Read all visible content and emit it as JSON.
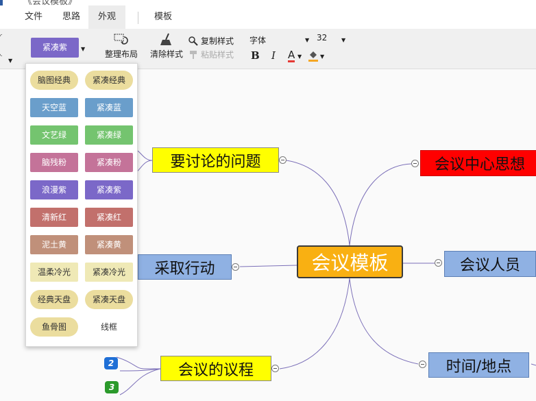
{
  "title": {
    "text": "《会议模板》"
  },
  "menu": {
    "tabs": [
      {
        "label": "文件"
      },
      {
        "label": "思路"
      },
      {
        "label": "外观"
      },
      {
        "label": "模板"
      }
    ]
  },
  "toolbar": {
    "theme_label": "紧凑紫",
    "layout_label": "整理布局",
    "clear_style_label": "清除样式",
    "copy_style_label": "复制样式",
    "paste_style_label": "粘贴样式",
    "font_name": "字体",
    "font_size": "32",
    "bold_label": "B",
    "italic_label": "I",
    "font_color_label": "A"
  },
  "theme_panel": {
    "rows": [
      [
        {
          "label": "脑图经典",
          "bg": "#ebdd9e",
          "shape": "pill"
        },
        {
          "label": "紧凑经典",
          "bg": "#ebdd9e",
          "shape": "pill"
        }
      ],
      [
        {
          "label": "天空蓝",
          "bg": "#6a9ecb"
        },
        {
          "label": "紧凑蓝",
          "bg": "#6a9ecb"
        }
      ],
      [
        {
          "label": "文艺绿",
          "bg": "#74c46f"
        },
        {
          "label": "紧凑绿",
          "bg": "#74c46f"
        }
      ],
      [
        {
          "label": "脑残粉",
          "bg": "#c47399"
        },
        {
          "label": "紧凑粉",
          "bg": "#c47399"
        }
      ],
      [
        {
          "label": "浪漫紫",
          "bg": "#7b68c8"
        },
        {
          "label": "紧凑紫",
          "bg": "#7b68c8"
        }
      ],
      [
        {
          "label": "清新红",
          "bg": "#c2706c"
        },
        {
          "label": "紧凑红",
          "bg": "#c2706c"
        }
      ],
      [
        {
          "label": "泥土黄",
          "bg": "#c0907a"
        },
        {
          "label": "紧凑黄",
          "bg": "#c0907a"
        }
      ],
      [
        {
          "label": "温柔冷光",
          "bg": "#efe9b6",
          "shape": "flat"
        },
        {
          "label": "紧凑冷光",
          "bg": "#efe9b6",
          "shape": "flat"
        }
      ],
      [
        {
          "label": "经典天盘",
          "bg": "#ebdd9e",
          "shape": "pill"
        },
        {
          "label": "紧凑天盘",
          "bg": "#ebdd9e",
          "shape": "pill"
        }
      ],
      [
        {
          "label": "鱼骨图",
          "bg": "#ebdd9e",
          "shape": "pill"
        },
        {
          "label": "线框",
          "bg": "#ffffff",
          "shape": "flat"
        }
      ]
    ]
  },
  "mindmap": {
    "root": "会议模板",
    "nodes": [
      {
        "id": "issues",
        "label": "要讨论的问题",
        "style": "yellow"
      },
      {
        "id": "action",
        "label": "采取行动",
        "style": "blue"
      },
      {
        "id": "agenda",
        "label": "会议的议程",
        "style": "yellow"
      },
      {
        "id": "center",
        "label": "会议中心思想",
        "style": "red"
      },
      {
        "id": "people",
        "label": "会议人员",
        "style": "blue"
      },
      {
        "id": "time",
        "label": "时间/地点",
        "style": "blue"
      }
    ],
    "badges": [
      {
        "label": "2",
        "color": "#1f6fd6"
      },
      {
        "label": "3",
        "color": "#2b9a2b"
      }
    ]
  }
}
